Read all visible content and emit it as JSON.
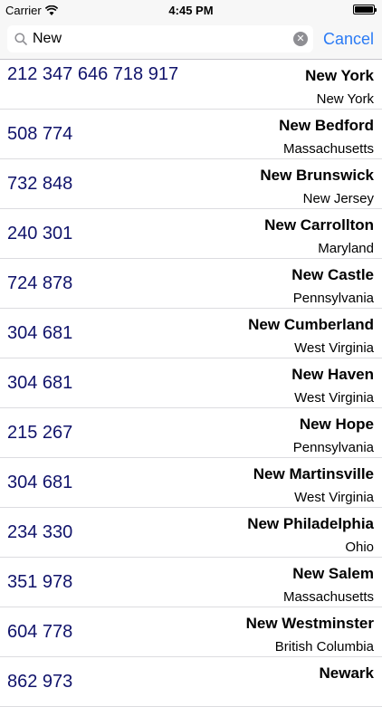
{
  "status_bar": {
    "carrier": "Carrier",
    "time": "4:45 PM",
    "battery_level": 1.0
  },
  "search": {
    "value": "New",
    "cancel_label": "Cancel",
    "clear_glyph": "✕"
  },
  "results": [
    {
      "codes": "212 347 646 718 917",
      "city": "New York",
      "state": "New York"
    },
    {
      "codes": "508 774",
      "city": "New Bedford",
      "state": "Massachusetts"
    },
    {
      "codes": "732 848",
      "city": "New Brunswick",
      "state": "New Jersey"
    },
    {
      "codes": "240 301",
      "city": "New Carrollton",
      "state": "Maryland"
    },
    {
      "codes": "724 878",
      "city": "New Castle",
      "state": "Pennsylvania"
    },
    {
      "codes": "304 681",
      "city": "New Cumberland",
      "state": "West Virginia"
    },
    {
      "codes": "304 681",
      "city": "New Haven",
      "state": "West Virginia"
    },
    {
      "codes": "215 267",
      "city": "New Hope",
      "state": "Pennsylvania"
    },
    {
      "codes": "304 681",
      "city": "New Martinsville",
      "state": "West Virginia"
    },
    {
      "codes": "234 330",
      "city": "New Philadelphia",
      "state": "Ohio"
    },
    {
      "codes": "351 978",
      "city": "New Salem",
      "state": "Massachusetts"
    },
    {
      "codes": "604 778",
      "city": "New Westminster",
      "state": "British Columbia"
    },
    {
      "codes": "862 973",
      "city": "Newark",
      "state": ""
    }
  ],
  "colors": {
    "accent": "#2b7bf5",
    "code_text": "#10136b",
    "bar_background": "#f7f7f7"
  },
  "icons": {
    "search": "search-icon",
    "clear": "clear-icon",
    "wifi": "wifi-icon",
    "battery": "battery-icon"
  }
}
